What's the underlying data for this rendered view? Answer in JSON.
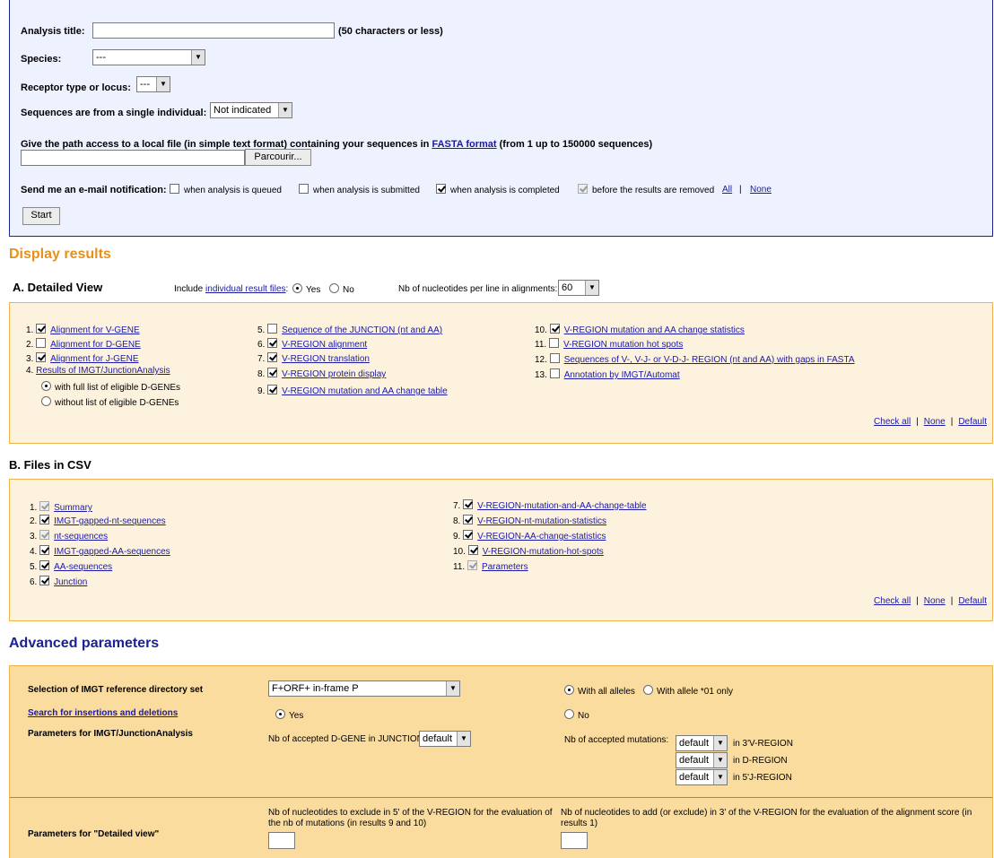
{
  "form": {
    "analysis_title_label": "Analysis title:",
    "analysis_title_hint": "(50 characters or less)",
    "analysis_title_value": "",
    "species_label": "Species:",
    "species_value": "---",
    "receptor_label": "Receptor type or locus:",
    "receptor_value": "---",
    "single_label": "Sequences are from a single individual:",
    "single_value": "Not indicated",
    "path_label_pre": "Give the path access to a local file (in simple text format) containing your sequences in ",
    "path_link": "FASTA format",
    "path_label_post": " (from 1 up to 150000 sequences)",
    "browse_label": "Parcourir...",
    "email_label": "Send me an e-mail notification:",
    "notify": [
      {
        "label": "when analysis is queued",
        "checked": false,
        "disabled": false
      },
      {
        "label": "when analysis is submitted",
        "checked": false,
        "disabled": false
      },
      {
        "label": "when analysis is completed",
        "checked": true,
        "disabled": false
      },
      {
        "label": "before the results are removed",
        "checked": true,
        "disabled": true
      }
    ],
    "notify_all": "All",
    "notify_none": "None",
    "start_label": "Start"
  },
  "display": {
    "heading": "Display results",
    "detailed_title": "A. Detailed View",
    "include_pre": "Include ",
    "include_link": "individual result files",
    "include_post": ":",
    "yes": "Yes",
    "no": "No",
    "nb_label": "Nb of nucleotides per line in alignments:",
    "nb_value": "60",
    "col1": [
      {
        "num": "1.",
        "label": "Alignment for V-GENE",
        "checked": true
      },
      {
        "num": "2.",
        "label": "Alignment for D-GENE",
        "checked": false
      },
      {
        "num": "3.",
        "label": "Alignment for J-GENE",
        "checked": true
      }
    ],
    "item4_num": "4.",
    "item4_label": "Results of IMGT/JunctionAnalysis",
    "item4_opt1": "with full list of eligible D-GENEs",
    "item4_opt2": "without list of eligible D-GENEs",
    "col2": [
      {
        "num": "5.",
        "label": "Sequence of the JUNCTION (nt and AA)",
        "checked": false
      },
      {
        "num": "6.",
        "label": "V-REGION alignment",
        "checked": true
      },
      {
        "num": "7.",
        "label": "V-REGION translation",
        "checked": true
      },
      {
        "num": "8.",
        "label": "V-REGION protein display",
        "checked": true
      },
      {
        "num": "9.",
        "label": "V-REGION mutation and AA change table",
        "checked": true
      }
    ],
    "col3": [
      {
        "num": "10.",
        "label": "V-REGION mutation and AA change statistics",
        "checked": true
      },
      {
        "num": "11.",
        "label": "V-REGION mutation hot spots",
        "checked": false
      },
      {
        "num": "12.",
        "label": "Sequences of V-, V-J- or V-D-J- REGION (nt and AA) with gaps in FASTA",
        "checked": false
      },
      {
        "num": "13.",
        "label": "Annotation by IMGT/Automat",
        "checked": false
      }
    ],
    "check_all": "Check all",
    "none": "None",
    "default": "Default"
  },
  "csv": {
    "title": "B. Files in CSV",
    "col1": [
      {
        "num": "1.",
        "label": "Summary",
        "checked": true,
        "disabled": true
      },
      {
        "num": "2.",
        "label": "IMGT-gapped-nt-sequences",
        "checked": true,
        "disabled": false
      },
      {
        "num": "3.",
        "label": "nt-sequences",
        "checked": true,
        "disabled": true
      },
      {
        "num": "4.",
        "label": "IMGT-gapped-AA-sequences",
        "checked": true,
        "disabled": false
      },
      {
        "num": "5.",
        "label": "AA-sequences",
        "checked": true,
        "disabled": false
      },
      {
        "num": "6.",
        "label": "Junction",
        "checked": true,
        "disabled": false
      }
    ],
    "col2": [
      {
        "num": "7.",
        "label": "V-REGION-mutation-and-AA-change-table",
        "checked": true,
        "disabled": false
      },
      {
        "num": "8.",
        "label": "V-REGION-nt-mutation-statistics",
        "checked": true,
        "disabled": false
      },
      {
        "num": "9.",
        "label": "V-REGION-AA-change-statistics",
        "checked": true,
        "disabled": false
      },
      {
        "num": "10.",
        "label": "V-REGION-mutation-hot-spots",
        "checked": true,
        "disabled": false
      },
      {
        "num": "11.",
        "label": "Parameters",
        "checked": true,
        "disabled": true
      }
    ],
    "check_all": "Check all",
    "none": "None",
    "default": "Default"
  },
  "advanced": {
    "heading": "Advanced parameters",
    "refdir_label": "Selection of IMGT reference directory set",
    "refdir_value": "F+ORF+ in-frame P",
    "with_all": "With all alleles",
    "with_01": "With allele *01 only",
    "indel_label": "Search for insertions and deletions",
    "yes": "Yes",
    "no": "No",
    "junction_label": "Parameters for IMGT/JunctionAnalysis",
    "dgene_label": "Nb of accepted D-GENE in JUNCTION",
    "dgene_value": "default",
    "mut_label": "Nb of accepted mutations:",
    "mut_rows": [
      {
        "value": "default",
        "label": "in 3'V-REGION"
      },
      {
        "value": "default",
        "label": "in D-REGION"
      },
      {
        "value": "default",
        "label": "in 5'J-REGION"
      }
    ],
    "detailed_label": "Parameters for \"Detailed view\"",
    "exclude_text_1": "Nb of nucleotides to exclude in 5' of the V-REGION for the evaluation of",
    "exclude_text_2": "the nb of mutations (in results 9 and 10)",
    "add_text_1": "Nb of nucleotides to add (or exclude) in 3' of the V-REGION for the evaluation of the alignment score (in",
    "add_text_2": "results 1)"
  },
  "colors": {
    "link": "#1a1aa6",
    "heading_orange": "#e8901a",
    "heading_blue": "#1a238f",
    "panel_blue": "#eef2ff",
    "box_light": "#fdf2de",
    "box_dark": "#fbdc9f"
  }
}
